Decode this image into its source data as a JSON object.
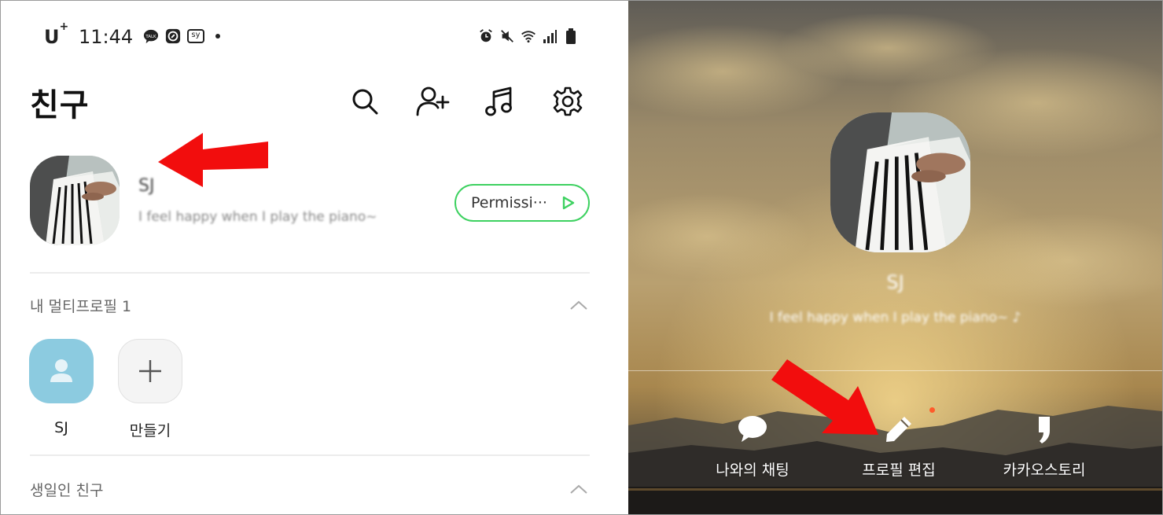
{
  "left": {
    "statusbar": {
      "carrier": "U",
      "carrier_sup": "+",
      "time": "11:44",
      "left_icons": [
        "talk-icon",
        "compass-icon",
        "sy-icon"
      ],
      "sy_text": "sy",
      "right_icons": [
        "alarm-icon",
        "mute-icon",
        "wifi-icon",
        "signal-icon",
        "battery-icon"
      ]
    },
    "header": {
      "title": "친구",
      "icons": [
        "search-icon",
        "add-friend-icon",
        "music-icon",
        "settings-icon"
      ]
    },
    "my_profile": {
      "name": "SJ",
      "status": "I feel happy when I play the piano~",
      "music_button": "Permissi···"
    },
    "multi_profile": {
      "title": "내 멀티프로필 1",
      "items": [
        {
          "label": "SJ"
        },
        {
          "label": "만들기"
        }
      ]
    },
    "birthday": {
      "title": "생일인 친구"
    }
  },
  "right": {
    "name": "SJ",
    "status": "I feel happy when I play the piano~ ♪",
    "actions": [
      {
        "label": "나와의 채팅",
        "icon": "chat-bubble-icon"
      },
      {
        "label": "프로필 편집",
        "icon": "pencil-icon"
      },
      {
        "label": "카카오스토리",
        "icon": "quote-icon"
      }
    ]
  },
  "colors": {
    "accent_green": "#3dd160",
    "arrow_red": "#f20d0d",
    "multi_avatar_bg": "#8ccbe0",
    "notification_dot": "#ff5a2a"
  }
}
